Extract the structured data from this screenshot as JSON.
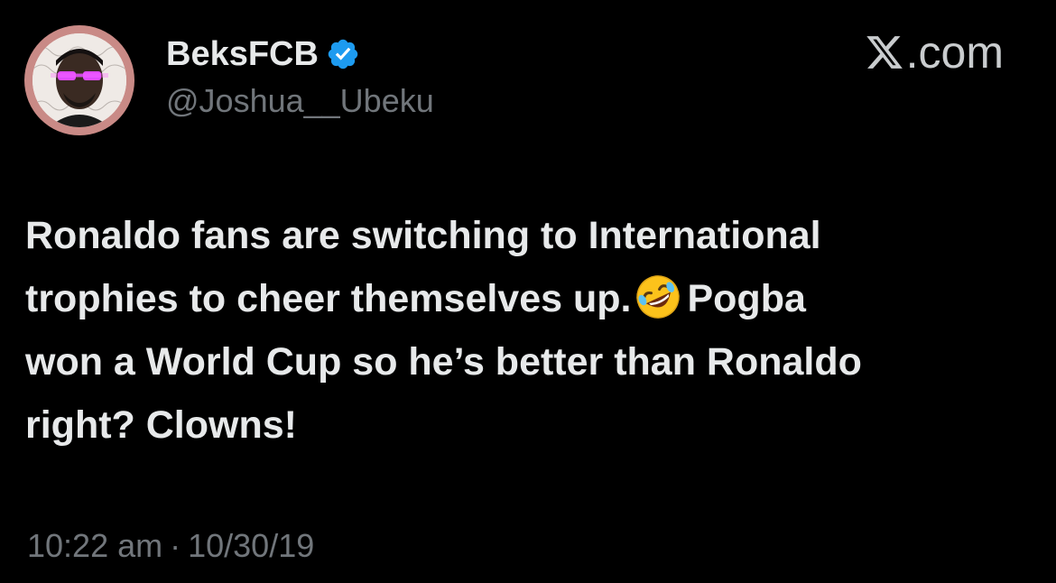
{
  "author": {
    "display_name": "BeksFCB",
    "handle": "@Joshua__Ubeku",
    "verified": true,
    "verified_icon": "verified-badge-icon",
    "avatar_icon": "profile-photo-avatar"
  },
  "brand": {
    "icon": "x-logo-icon",
    "text": ".com"
  },
  "tweet": {
    "lines": [
      "Ronaldo fans are switching to International",
      "trophies to cheer themselves up.",
      "Pogba",
      "won a World Cup so he’s better than Ronaldo",
      "right? Clowns!"
    ],
    "emoji": "rolling-on-floor-laughing-emoji"
  },
  "meta": {
    "time": "10:22 am",
    "separator": "·",
    "date": "10/30/19"
  },
  "colors": {
    "background": "#000000",
    "text_primary": "#e7e9ea",
    "text_secondary": "#71767b",
    "verified_blue": "#1d9bf0",
    "avatar_ring": "#c98a86"
  }
}
